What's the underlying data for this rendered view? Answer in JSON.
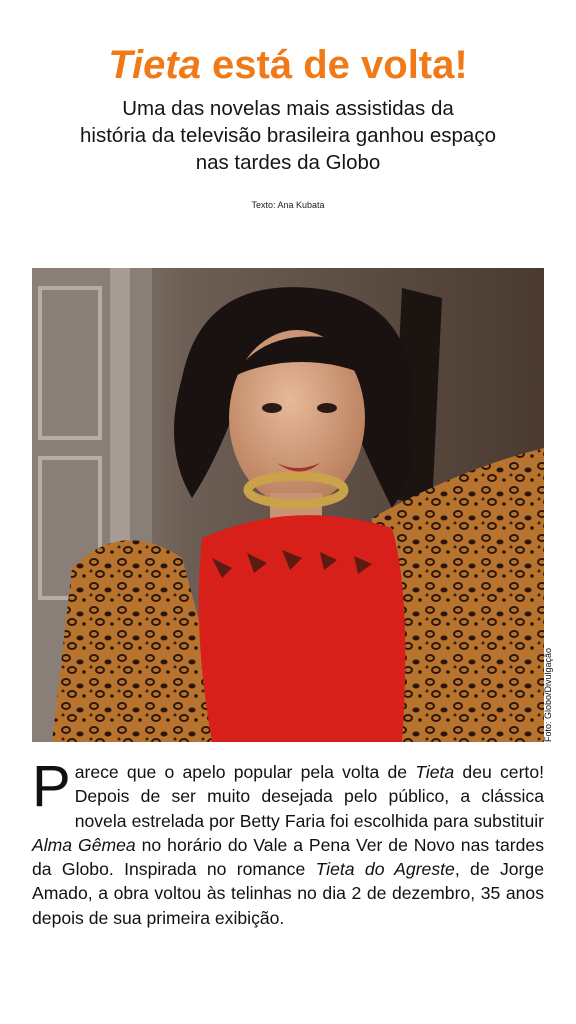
{
  "header": {
    "title_italic": "Tieta",
    "title_rest": " está de volta!",
    "subtitle_lines": [
      "Uma das novelas mais assistidas da",
      "história da televisão brasileira ganhou espaço",
      "nas tardes da Globo"
    ],
    "author_credit": "Texto: Ana Kubata"
  },
  "photo": {
    "alt": "Atriz de vestido vermelho e xale de oncinha",
    "credit": "Foto: Globo/Divulgação"
  },
  "article": {
    "drop_cap": "P",
    "segments": [
      {
        "text": "arece que o apelo popular pela volta de ",
        "italic": false
      },
      {
        "text": "Tieta",
        "italic": true
      },
      {
        "text": " deu certo! Depois de ser muito desejada pelo público, a clássica novela estrelada por Betty Faria foi escolhida para substituir ",
        "italic": false
      },
      {
        "text": "Alma Gêmea",
        "italic": true
      },
      {
        "text": " no horário do Vale a Pena Ver de Novo nas tardes da Globo. Inspirada no roman­ce ",
        "italic": false
      },
      {
        "text": "Tieta do Agreste",
        "italic": true
      },
      {
        "text": ", de Jorge Amado, a obra voltou às telinhas no dia 2 de dezembro, 35 anos depois de sua primeira exibição.",
        "italic": false
      }
    ]
  },
  "colors": {
    "accent": "#f07a18",
    "dress": "#d8201a"
  }
}
